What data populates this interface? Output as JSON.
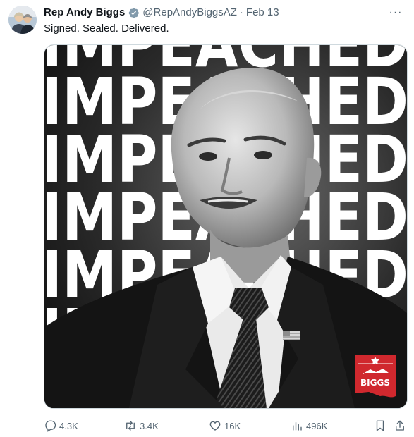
{
  "tweet": {
    "author_name": "Rep Andy Biggs",
    "handle": "@RepAndyBiggsAZ",
    "separator": "·",
    "date": "Feb 13",
    "text": "Signed. Sealed. Delivered.",
    "more_label": "···"
  },
  "media": {
    "rows": [
      "IMPEACHED",
      "IMPEACHED",
      "IMPEACHED",
      "IMPEACHED",
      "IMPEACHED",
      "IMPEACHED"
    ],
    "badge_name": "BIGGS"
  },
  "stats": {
    "replies": "4.3K",
    "reposts": "3.4K",
    "likes": "16K",
    "views": "496K"
  },
  "colors": {
    "text_primary": "#0f1419",
    "text_secondary": "#536471",
    "verified_badge": "#829aab",
    "badge_red": "#d0282e"
  }
}
